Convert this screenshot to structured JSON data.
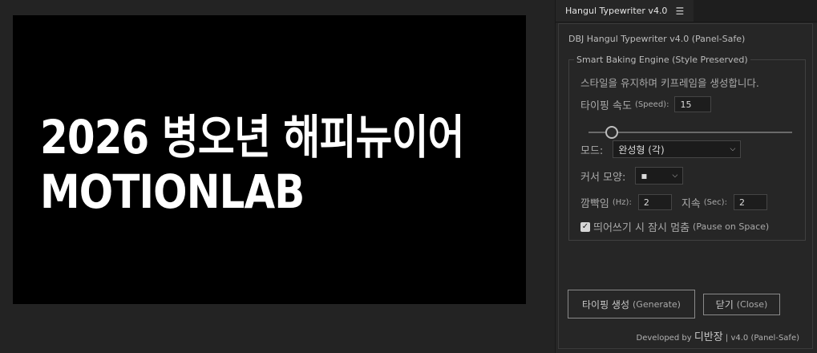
{
  "comp": {
    "line1": "2026 병오년 해피뉴이어",
    "line2": "MOTIONLAB"
  },
  "panel": {
    "tab_title": "Hangul Typewriter v4.0",
    "menu_icon": "hamburger-menu-icon",
    "header": "DBJ Hangul Typewriter v4.0 (Panel-Safe)",
    "engine_legend": "Smart Baking Engine (Style Preserved)",
    "engine_desc": "스타일을 유지하며 키프레임을 생성합니다.",
    "speed_label": "타이핑 속도",
    "speed_label_en": "(Speed):",
    "speed_value": "15",
    "speed_slider_fraction": 0.12,
    "mode_label": "모드:",
    "mode_value": "완성형 (각)",
    "cursor_label": "커서 모양:",
    "cursor_value": "▪",
    "blink_label": "깜빡임",
    "blink_label_en": "(Hz):",
    "blink_value": "2",
    "duration_label": "지속",
    "duration_label_en": "(Sec):",
    "duration_value": "2",
    "pause_checked": true,
    "pause_label": "띄어쓰기 시 잠시 멈춤",
    "pause_label_en": "(Pause on Space)",
    "generate_label": "타이핑 생성",
    "generate_label_en": "(Generate)",
    "close_label": "닫기",
    "close_label_en": "(Close)",
    "footer_prefix": "Developed by",
    "footer_author": "디반장",
    "footer_suffix": "| v4.0 (Panel-Safe)"
  },
  "colors": {
    "background": "#232323",
    "comp_bg": "#000000",
    "comp_text": "#ffffff",
    "panel_bg": "#262626"
  }
}
